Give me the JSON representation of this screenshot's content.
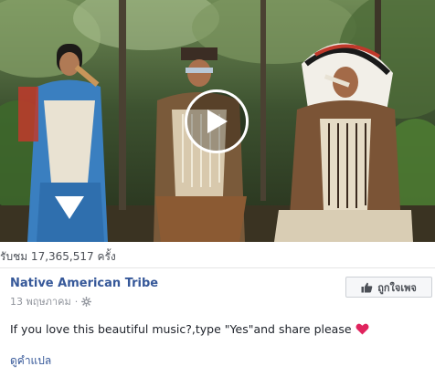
{
  "video": {
    "view_count_text": "รับชม 17,365,517 ครั้ง"
  },
  "post": {
    "page_name": "Native American Tribe",
    "date": "13 พฤษภาคม",
    "separator": "·",
    "like_button_label": "ถูกใจเพจ",
    "message": "If you love this beautiful music?,type \"Yes\"and share please",
    "translate_link": "ดูคำแปล"
  },
  "colors": {
    "link_blue": "#365899",
    "heart": "#e0245e",
    "muted": "#90949c"
  },
  "icons": {
    "play": "play-icon",
    "privacy": "gear-icon",
    "like": "thumbs-up-icon",
    "heart": "heart-icon"
  }
}
